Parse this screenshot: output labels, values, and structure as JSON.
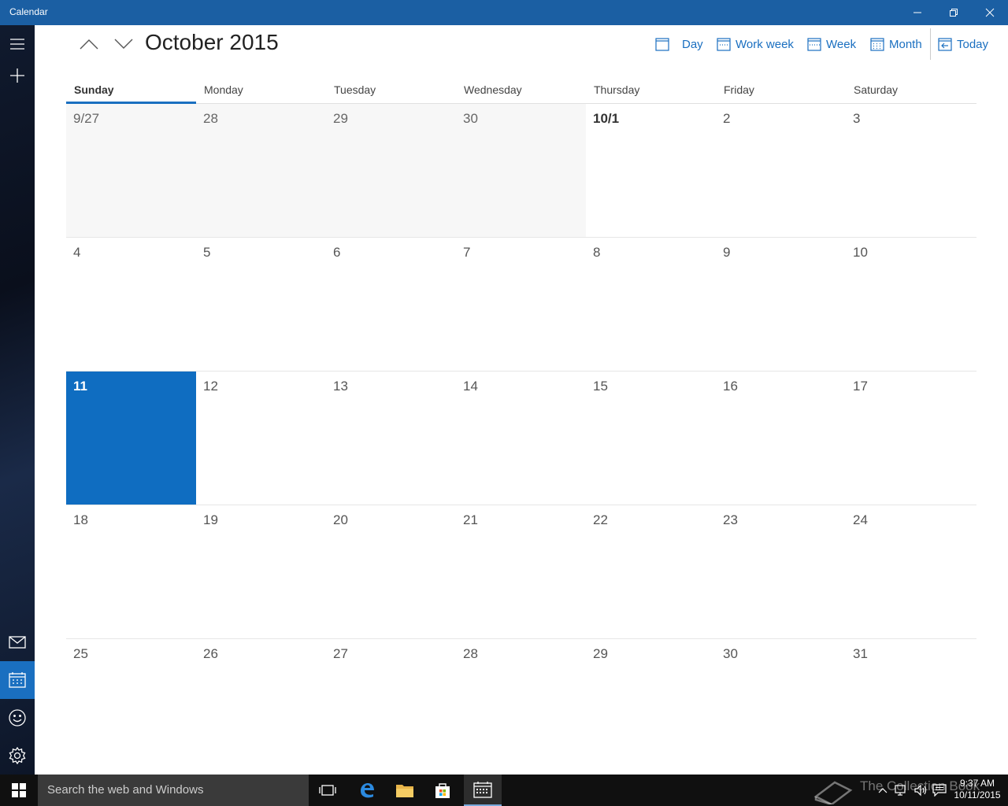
{
  "window": {
    "title": "Calendar"
  },
  "header": {
    "month_title": "October 2015",
    "views": {
      "day": "Day",
      "work_week": "Work week",
      "week": "Week",
      "month": "Month",
      "today": "Today"
    }
  },
  "weekdays": [
    "Sunday",
    "Monday",
    "Tuesday",
    "Wednesday",
    "Thursday",
    "Friday",
    "Saturday"
  ],
  "weeks": [
    [
      "9/27",
      "28",
      "29",
      "30",
      "10/1",
      "2",
      "3"
    ],
    [
      "4",
      "5",
      "6",
      "7",
      "8",
      "9",
      "10"
    ],
    [
      "11",
      "12",
      "13",
      "14",
      "15",
      "16",
      "17"
    ],
    [
      "18",
      "19",
      "20",
      "21",
      "22",
      "23",
      "24"
    ],
    [
      "25",
      "26",
      "27",
      "28",
      "29",
      "30",
      "31"
    ]
  ],
  "taskbar": {
    "search_placeholder": "Search the web and Windows",
    "watermark": "The Collection Book",
    "time": "9:37 AM",
    "date": "10/11/2015"
  },
  "colors": {
    "accent": "#1a6fc0",
    "titlebar": "#1b5fa3",
    "today_cell": "#0f6dc1"
  }
}
